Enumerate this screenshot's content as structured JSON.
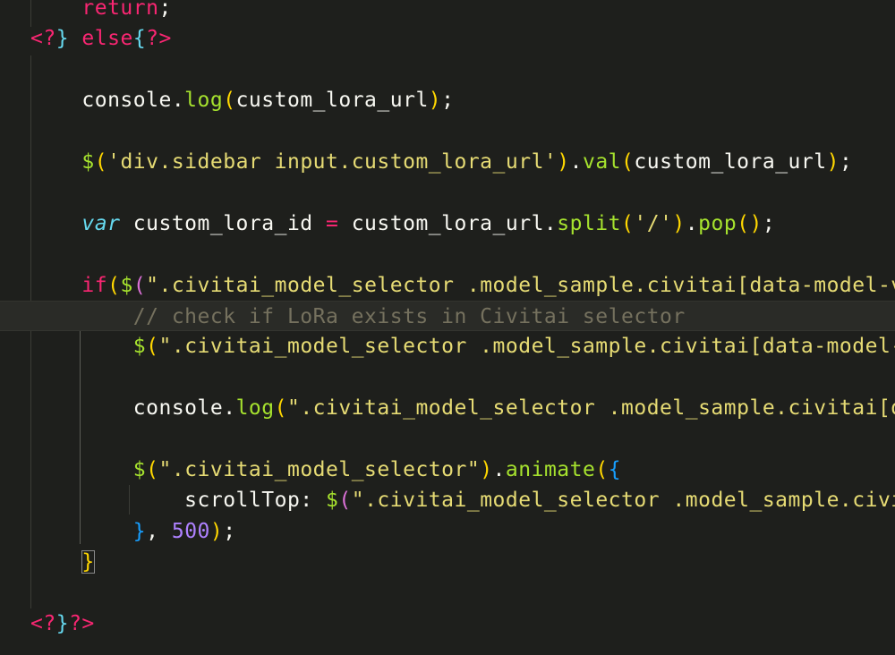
{
  "editor": {
    "theme_colors": {
      "background": "#1e1f1c",
      "keyword": "#f92672",
      "function": "#a6e22e",
      "string": "#e6db74",
      "number": "#ae81ff",
      "comment": "#75715e",
      "storage": "#66d9ef",
      "bracket1": "#ffd700",
      "bracket2": "#da70d6",
      "bracket3": "#179fff"
    },
    "lines": [
      [
        {
          "t": "    "
        },
        {
          "t": "return",
          "c": "t-kw"
        },
        {
          "t": ";"
        }
      ],
      [
        {
          "t": "<?",
          "c": "t-php"
        },
        {
          "t": "}",
          "c": "t-phpb"
        },
        {
          "t": " "
        },
        {
          "t": "else",
          "c": "t-kw"
        },
        {
          "t": "{",
          "c": "t-phpb"
        },
        {
          "t": "?>",
          "c": "t-php"
        }
      ],
      [],
      [
        {
          "t": "    console."
        },
        {
          "t": "log",
          "c": "t-fn"
        },
        {
          "t": "(",
          "c": "t-p1"
        },
        {
          "t": "custom_lora_url"
        },
        {
          "t": ")",
          "c": "t-p1"
        },
        {
          "t": ";"
        }
      ],
      [],
      [
        {
          "t": "    "
        },
        {
          "t": "$",
          "c": "t-fn"
        },
        {
          "t": "(",
          "c": "t-p1"
        },
        {
          "t": "'div.sidebar input.custom_lora_url'",
          "c": "t-str"
        },
        {
          "t": ")",
          "c": "t-p1"
        },
        {
          "t": "."
        },
        {
          "t": "val",
          "c": "t-fn"
        },
        {
          "t": "(",
          "c": "t-p1"
        },
        {
          "t": "custom_lora_url"
        },
        {
          "t": ")",
          "c": "t-p1"
        },
        {
          "t": ";"
        }
      ],
      [],
      [
        {
          "t": "    "
        },
        {
          "t": "var",
          "c": "t-var"
        },
        {
          "t": " custom_lora_id "
        },
        {
          "t": "=",
          "c": "t-op"
        },
        {
          "t": " custom_lora_url."
        },
        {
          "t": "split",
          "c": "t-fn"
        },
        {
          "t": "(",
          "c": "t-p1"
        },
        {
          "t": "'/'",
          "c": "t-str"
        },
        {
          "t": ")",
          "c": "t-p1"
        },
        {
          "t": "."
        },
        {
          "t": "pop",
          "c": "t-fn"
        },
        {
          "t": "()",
          "c": "t-p1"
        },
        {
          "t": ";"
        }
      ],
      [],
      [
        {
          "t": "    "
        },
        {
          "t": "if",
          "c": "t-kw"
        },
        {
          "t": "(",
          "c": "t-p1"
        },
        {
          "t": "$",
          "c": "t-fn"
        },
        {
          "t": "(",
          "c": "t-p2"
        },
        {
          "t": "\".civitai_model_selector .model_sample.civitai[data-model-ver",
          "c": "t-str"
        }
      ],
      [
        {
          "t": "        "
        },
        {
          "t": "// check if LoRa exists in Civitai selector",
          "c": "t-cmt"
        }
      ],
      [
        {
          "t": "        "
        },
        {
          "t": "$",
          "c": "t-fn"
        },
        {
          "t": "(",
          "c": "t-p1"
        },
        {
          "t": "\".civitai_model_selector .model_sample.civitai[data-model-ve",
          "c": "t-str"
        }
      ],
      [],
      [
        {
          "t": "        console."
        },
        {
          "t": "log",
          "c": "t-fn"
        },
        {
          "t": "(",
          "c": "t-p1"
        },
        {
          "t": "\".civitai_model_selector .model_sample.civitai[dat",
          "c": "t-str"
        }
      ],
      [],
      [
        {
          "t": "        "
        },
        {
          "t": "$",
          "c": "t-fn"
        },
        {
          "t": "(",
          "c": "t-p1"
        },
        {
          "t": "\".civitai_model_selector\"",
          "c": "t-str"
        },
        {
          "t": ")",
          "c": "t-p1"
        },
        {
          "t": "."
        },
        {
          "t": "animate",
          "c": "t-fn"
        },
        {
          "t": "(",
          "c": "t-p1"
        },
        {
          "t": "{",
          "c": "t-p3"
        }
      ],
      [
        {
          "t": "            scrollTop: "
        },
        {
          "t": "$",
          "c": "t-fn"
        },
        {
          "t": "(",
          "c": "t-p2"
        },
        {
          "t": "\".civitai_model_selector .model_sample.civita",
          "c": "t-str"
        }
      ],
      [
        {
          "t": "        "
        },
        {
          "t": "}",
          "c": "t-p3"
        },
        {
          "t": ", "
        },
        {
          "t": "500",
          "c": "t-num"
        },
        {
          "t": ")",
          "c": "t-p1"
        },
        {
          "t": ";"
        }
      ],
      [
        {
          "t": "    "
        },
        {
          "t": "}",
          "c": "t-brace-match"
        }
      ],
      [],
      [
        {
          "t": "<?",
          "c": "t-php"
        },
        {
          "t": "}",
          "c": "t-phpb"
        },
        {
          "t": "?>",
          "c": "t-php"
        }
      ]
    ]
  }
}
